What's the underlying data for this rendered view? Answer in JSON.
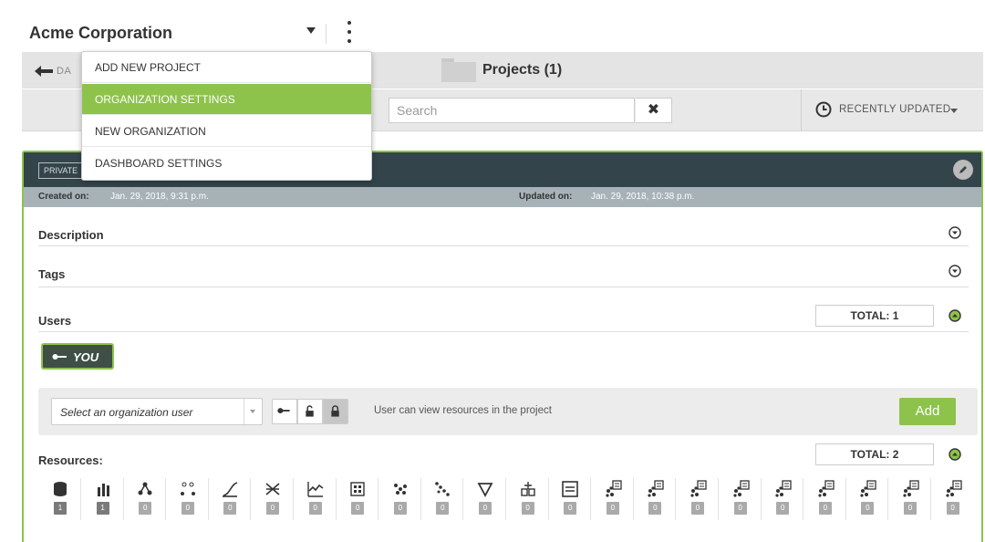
{
  "organization": {
    "name": "Acme Corporation"
  },
  "org_menu": {
    "items": [
      {
        "label": "ADD NEW PROJECT",
        "active": false
      },
      {
        "label": "ORGANIZATION SETTINGS",
        "active": true
      },
      {
        "label": "NEW ORGANIZATION",
        "active": false
      },
      {
        "label": "DASHBOARD SETTINGS",
        "active": false
      }
    ]
  },
  "nav": {
    "back_label": "DA",
    "title": "Projects (1)"
  },
  "toolbar": {
    "search_placeholder": "Search",
    "sort_label": "RECENTLY UPDATED"
  },
  "project": {
    "visibility": "PRIVATE",
    "created_label": "Created on:",
    "created_value": "Jan. 29, 2018, 9:31 p.m.",
    "updated_label": "Updated on:",
    "updated_value": "Jan. 29, 2018, 10:38 p.m.",
    "sections": {
      "description": "Description",
      "tags": "Tags",
      "users": "Users",
      "resources": "Resources:"
    },
    "users_total": "TOTAL: 1",
    "resources_total": "TOTAL: 2",
    "you_label": "YOU",
    "user_select_label": "Select an organization user",
    "permission_description": "User can view resources in the project",
    "add_label": "Add",
    "resource_counts": [
      "1",
      "1",
      "0",
      "0",
      "0",
      "0",
      "0",
      "0",
      "0",
      "0",
      "0",
      "0",
      "0",
      "0",
      "0",
      "0",
      "0",
      "0",
      "0",
      "0",
      "0",
      "0"
    ],
    "resource_icons": [
      "source-icon",
      "dataset-icon",
      "model-icon",
      "ensemble-icon",
      "logistic-regression-icon",
      "deepnet-icon",
      "time-series-icon",
      "cluster-icon",
      "anomaly-icon",
      "association-icon",
      "topic-model-icon",
      "pca-icon",
      "fusion-icon",
      "batch-prediction-icon",
      "batch-centroid-icon",
      "batch-anomaly-score-icon",
      "batch-topic-distribution-icon",
      "batch-projection-icon",
      "prediction-icon",
      "centroid-icon",
      "anomaly-score-icon",
      "topic-distribution-icon"
    ]
  }
}
